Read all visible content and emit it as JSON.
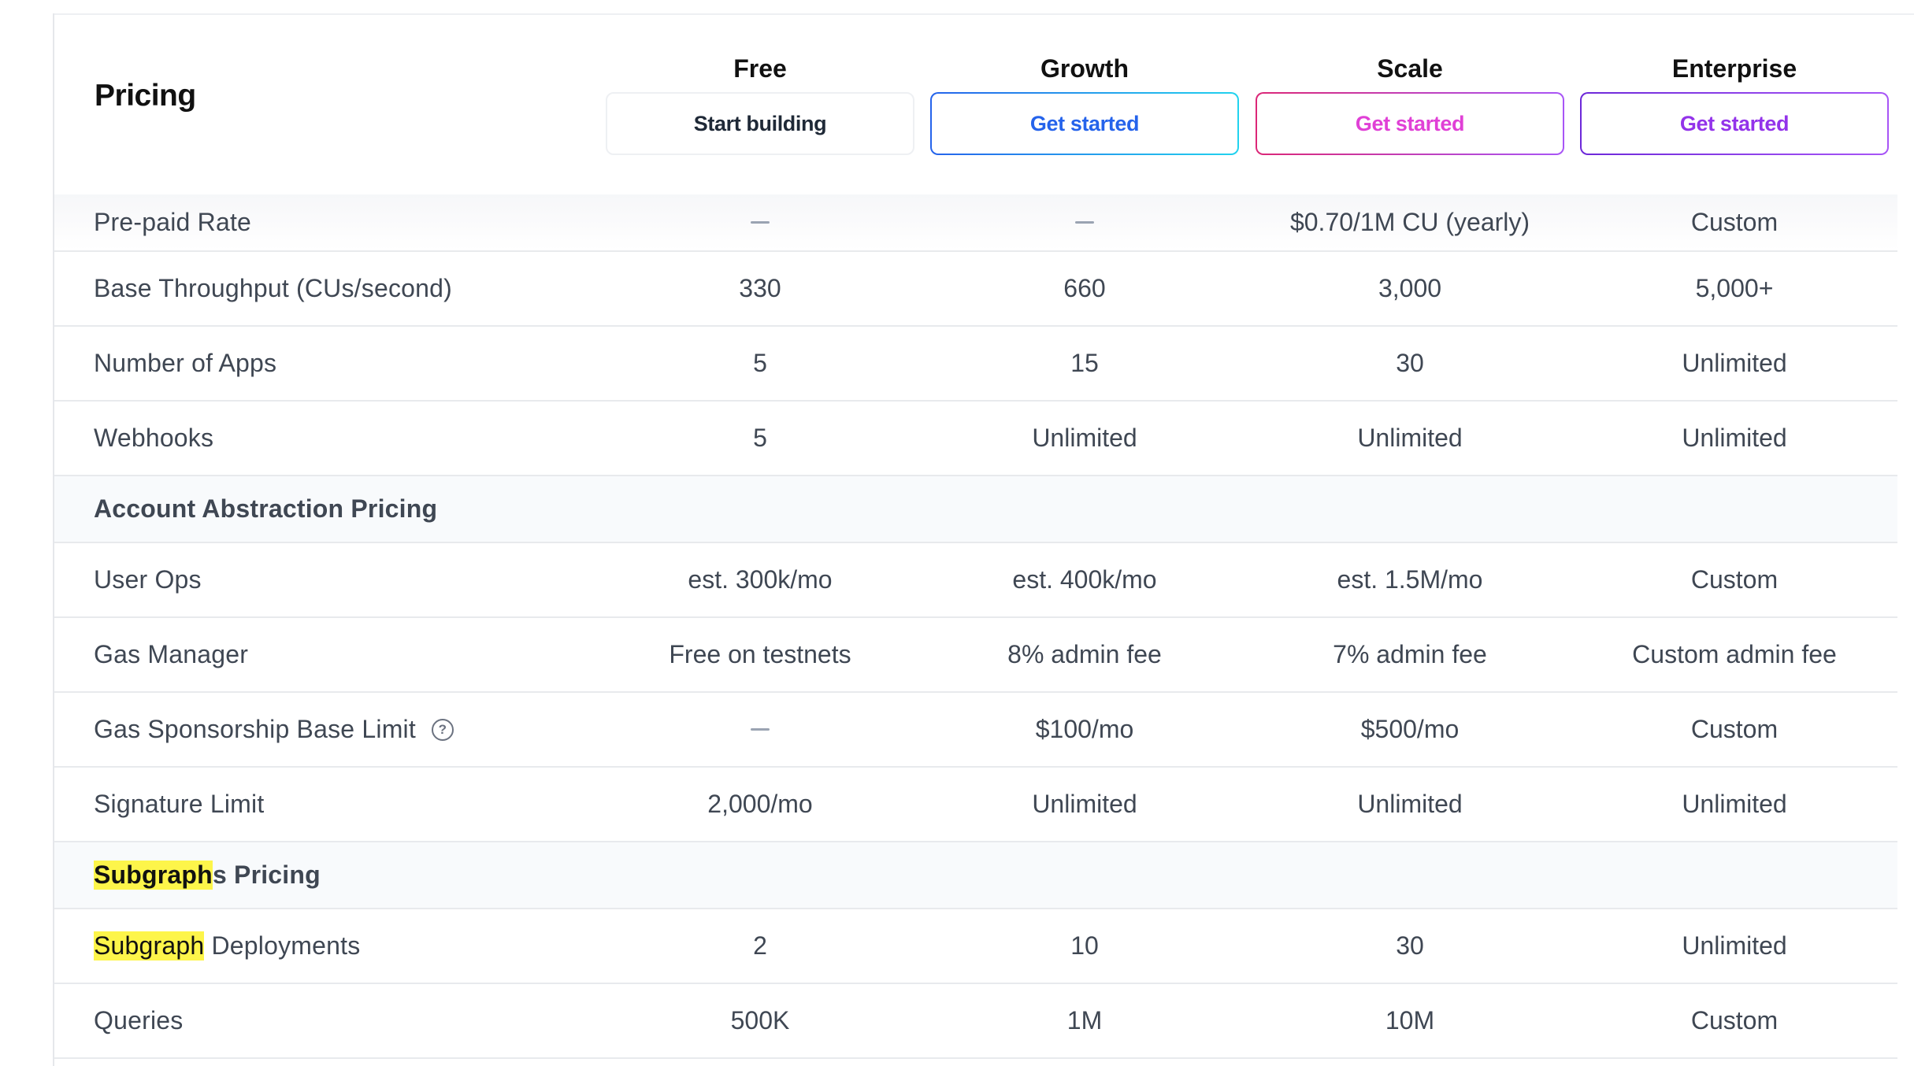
{
  "header": {
    "title": "Pricing",
    "plans": [
      {
        "name": "Free",
        "button": "Start building"
      },
      {
        "name": "Growth",
        "button": "Get started"
      },
      {
        "name": "Scale",
        "button": "Get started"
      },
      {
        "name": "Enterprise",
        "button": "Get started"
      }
    ]
  },
  "rows": {
    "prepaid": {
      "label": "Pre-paid Rate",
      "values": [
        "—",
        "—",
        "$0.70/1M CU (yearly)",
        "Custom"
      ]
    },
    "throughput": {
      "label": "Base Throughput (CUs/second)",
      "values": [
        "330",
        "660",
        "3,000",
        "5,000+"
      ]
    },
    "apps": {
      "label": "Number of Apps",
      "values": [
        "5",
        "15",
        "30",
        "Unlimited"
      ]
    },
    "webhooks": {
      "label": "Webhooks",
      "values": [
        "5",
        "Unlimited",
        "Unlimited",
        "Unlimited"
      ]
    },
    "aa_section": {
      "label": "Account Abstraction Pricing"
    },
    "user_ops": {
      "label": "User Ops",
      "values": [
        "est. 300k/mo",
        "est. 400k/mo",
        "est. 1.5M/mo",
        "Custom"
      ]
    },
    "gas_manager": {
      "label": "Gas Manager",
      "values": [
        "Free on testnets",
        "8% admin fee",
        "7% admin fee",
        "Custom admin fee"
      ]
    },
    "gas_sponsorship": {
      "label": "Gas Sponsorship Base Limit",
      "help_icon": "question-circle-icon",
      "values": [
        "—",
        "$100/mo",
        "$500/mo",
        "Custom"
      ]
    },
    "signature": {
      "label": "Signature Limit",
      "values": [
        "2,000/mo",
        "Unlimited",
        "Unlimited",
        "Unlimited"
      ]
    },
    "subgraphs_section": {
      "label_highlight": "Subgraph",
      "label_rest": "s Pricing"
    },
    "subgraph_deployments": {
      "label_highlight": "Subgraph",
      "label_rest": " Deployments",
      "values": [
        "2",
        "10",
        "30",
        "Unlimited"
      ]
    },
    "queries": {
      "label": "Queries",
      "values": [
        "500K",
        "1M",
        "10M",
        "Custom"
      ]
    }
  },
  "colors": {
    "highlight": "#fdf54a",
    "growth_accent": "#2563eb",
    "scale_accent": "#e040d6",
    "enterprise_accent": "#9333ea"
  }
}
